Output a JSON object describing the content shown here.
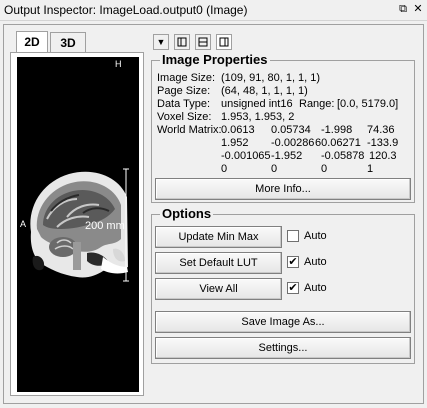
{
  "window": {
    "title": "Output Inspector: ImageLoad.output0 (Image)",
    "float_icon": "float-icon",
    "close_icon": "close-icon"
  },
  "tabs": [
    {
      "label": "2D"
    },
    {
      "label": "3D"
    }
  ],
  "toolbar": {
    "dropdown_icon": "triangle-down-icon",
    "layout_icons": [
      "layout-vertical-icon",
      "layout-horizontal-icon",
      "layout-single-icon"
    ]
  },
  "viewer": {
    "orientation_top": "H",
    "orientation_left": "A",
    "scale_label": "200 mm"
  },
  "properties": {
    "title": "Image Properties",
    "image_size_label": "Image Size:",
    "image_size": "(109, 91, 80, 1, 1, 1)",
    "page_size_label": "Page Size:",
    "page_size": "(64, 48, 1, 1, 1, 1)",
    "data_type_label": "Data Type:",
    "data_type": "unsigned int16",
    "range_label": "Range:",
    "range": "[0.0, 5179.0]",
    "voxel_size_label": "Voxel Size:",
    "voxel_size": "1.953, 1.953, 2",
    "world_matrix_label": "World Matrix:",
    "matrix": [
      [
        "0.0613",
        "0.05734",
        "-1.998",
        "74.36"
      ],
      [
        "1.952",
        "-0.00286",
        "60.06271",
        "-133.9"
      ],
      [
        "-0.001065",
        "-1.952",
        "-0.05878",
        "120.3"
      ],
      [
        "0",
        "0",
        "0",
        "1"
      ]
    ],
    "more_info": "More Info..."
  },
  "options": {
    "title": "Options",
    "update_min_max": "Update Min Max",
    "update_auto_label": "Auto",
    "update_auto_checked": false,
    "set_default_lut": "Set Default LUT",
    "lut_auto_label": "Auto",
    "lut_auto_checked": true,
    "view_all": "View All",
    "view_auto_label": "Auto",
    "view_auto_checked": true,
    "save_image": "Save Image As...",
    "settings": "Settings..."
  },
  "glyphs": {
    "check": "✔",
    "close": "✕",
    "float": "⧉",
    "triangle": "▼"
  }
}
